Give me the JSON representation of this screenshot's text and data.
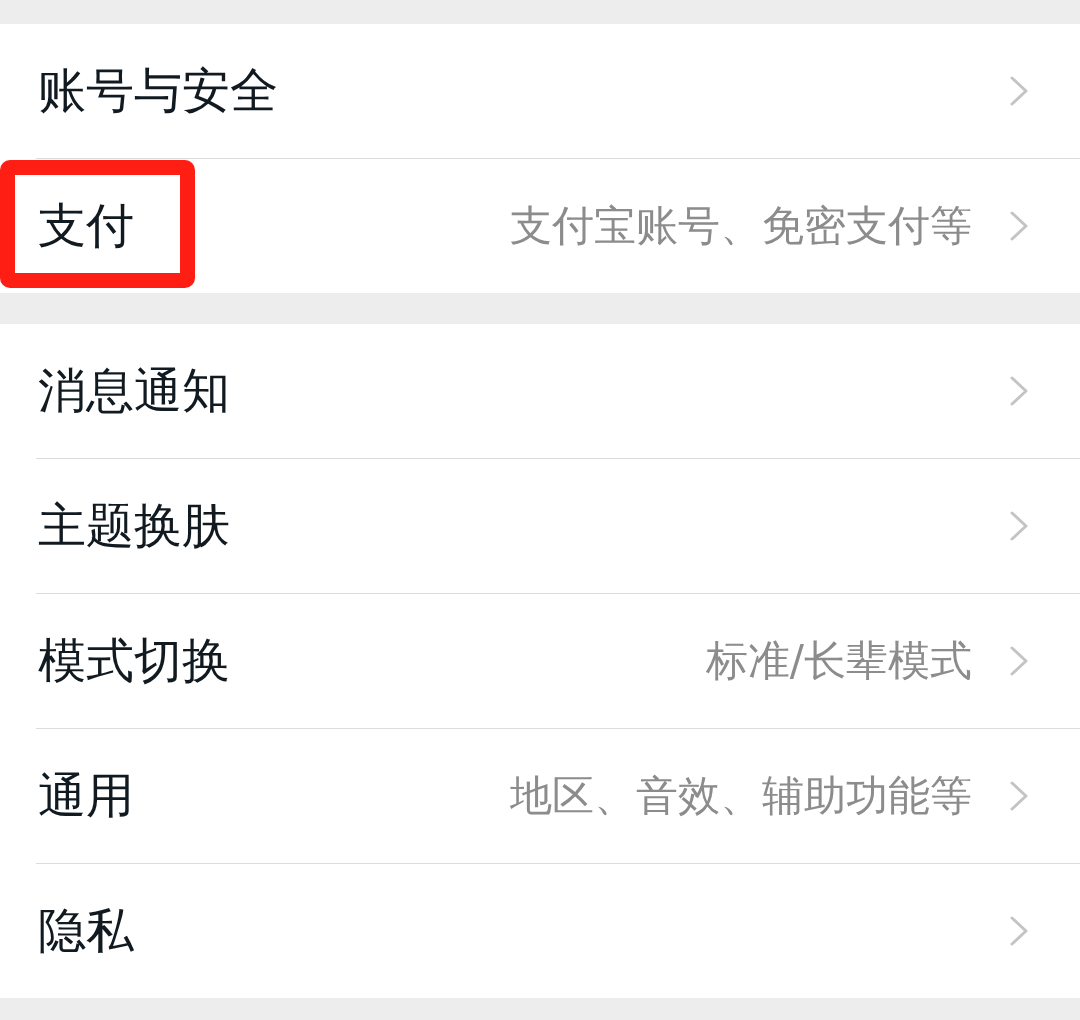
{
  "groups": [
    {
      "items": [
        {
          "label": "账号与安全",
          "highlighted": false
        },
        {
          "label": "支付",
          "value": "支付宝账号、免密支付等",
          "highlighted": true
        }
      ]
    },
    {
      "items": [
        {
          "label": "消息通知",
          "highlighted": false
        },
        {
          "label": "主题换肤",
          "highlighted": false
        },
        {
          "label": "模式切换",
          "value": "标准/长辈模式",
          "highlighted": false
        },
        {
          "label": "通用",
          "value": "地区、音效、辅助功能等",
          "highlighted": false
        },
        {
          "label": "隐私",
          "highlighted": false
        }
      ]
    }
  ]
}
